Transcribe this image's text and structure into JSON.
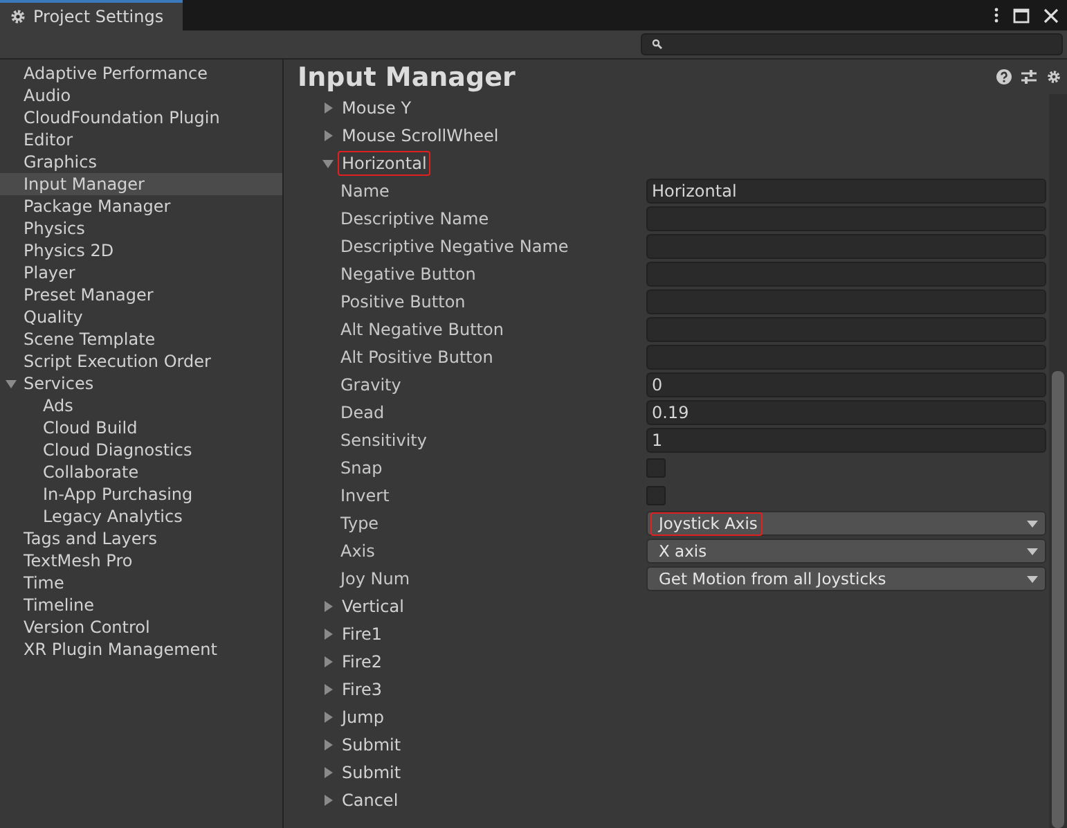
{
  "window": {
    "title": "Project Settings"
  },
  "sidebar": {
    "items": [
      {
        "label": "Adaptive Performance",
        "selected": false
      },
      {
        "label": "Audio",
        "selected": false
      },
      {
        "label": "CloudFoundation Plugin",
        "selected": false
      },
      {
        "label": "Editor",
        "selected": false
      },
      {
        "label": "Graphics",
        "selected": false
      },
      {
        "label": "Input Manager",
        "selected": true
      },
      {
        "label": "Package Manager",
        "selected": false
      },
      {
        "label": "Physics",
        "selected": false
      },
      {
        "label": "Physics 2D",
        "selected": false
      },
      {
        "label": "Player",
        "selected": false
      },
      {
        "label": "Preset Manager",
        "selected": false
      },
      {
        "label": "Quality",
        "selected": false
      },
      {
        "label": "Scene Template",
        "selected": false
      },
      {
        "label": "Script Execution Order",
        "selected": false
      },
      {
        "label": "Services",
        "selected": false,
        "expanded": true,
        "children": [
          {
            "label": "Ads",
            "selected": false
          },
          {
            "label": "Cloud Build",
            "selected": false
          },
          {
            "label": "Cloud Diagnostics",
            "selected": false
          },
          {
            "label": "Collaborate",
            "selected": false
          },
          {
            "label": "In-App Purchasing",
            "selected": false
          },
          {
            "label": "Legacy Analytics",
            "selected": false
          }
        ]
      },
      {
        "label": "Tags and Layers",
        "selected": false
      },
      {
        "label": "TextMesh Pro",
        "selected": false
      },
      {
        "label": "Time",
        "selected": false
      },
      {
        "label": "Timeline",
        "selected": false
      },
      {
        "label": "Version Control",
        "selected": false
      },
      {
        "label": "XR Plugin Management",
        "selected": false
      }
    ]
  },
  "content": {
    "title": "Input Manager",
    "axes": [
      {
        "label": "Mouse Y",
        "expanded": false,
        "highlighted": false
      },
      {
        "label": "Mouse ScrollWheel",
        "expanded": false,
        "highlighted": false
      },
      {
        "label": "Horizontal",
        "expanded": true,
        "highlighted": true,
        "fields": [
          {
            "label": "Name",
            "kind": "text",
            "value": "Horizontal"
          },
          {
            "label": "Descriptive Name",
            "kind": "text"
          },
          {
            "label": "Descriptive Negative Name",
            "kind": "text"
          },
          {
            "label": "Negative Button",
            "kind": "text"
          },
          {
            "label": "Positive Button",
            "kind": "text"
          },
          {
            "label": "Alt Negative Button",
            "kind": "text"
          },
          {
            "label": "Alt Positive Button",
            "kind": "text"
          },
          {
            "label": "Gravity",
            "kind": "text",
            "value": "0"
          },
          {
            "label": "Dead",
            "kind": "text",
            "value": "0.19"
          },
          {
            "label": "Sensitivity",
            "kind": "text",
            "value": "1"
          },
          {
            "label": "Snap",
            "kind": "checkbox",
            "checked": false
          },
          {
            "label": "Invert",
            "kind": "checkbox",
            "checked": false
          },
          {
            "label": "Type",
            "kind": "dropdown",
            "value": "Joystick Axis",
            "highlighted": true
          },
          {
            "label": "Axis",
            "kind": "dropdown",
            "value": "X axis",
            "highlighted": false
          },
          {
            "label": "Joy Num",
            "kind": "dropdown",
            "value": "Get Motion from all Joysticks",
            "highlighted": false
          }
        ]
      },
      {
        "label": "Vertical",
        "expanded": false,
        "highlighted": false
      },
      {
        "label": "Fire1",
        "expanded": false,
        "highlighted": false
      },
      {
        "label": "Fire2",
        "expanded": false,
        "highlighted": false
      },
      {
        "label": "Fire3",
        "expanded": false,
        "highlighted": false
      },
      {
        "label": "Jump",
        "expanded": false,
        "highlighted": false
      },
      {
        "label": "Submit",
        "expanded": false,
        "highlighted": false
      },
      {
        "label": "Submit",
        "expanded": false,
        "highlighted": false
      },
      {
        "label": "Cancel",
        "expanded": false,
        "highlighted": false
      }
    ]
  }
}
